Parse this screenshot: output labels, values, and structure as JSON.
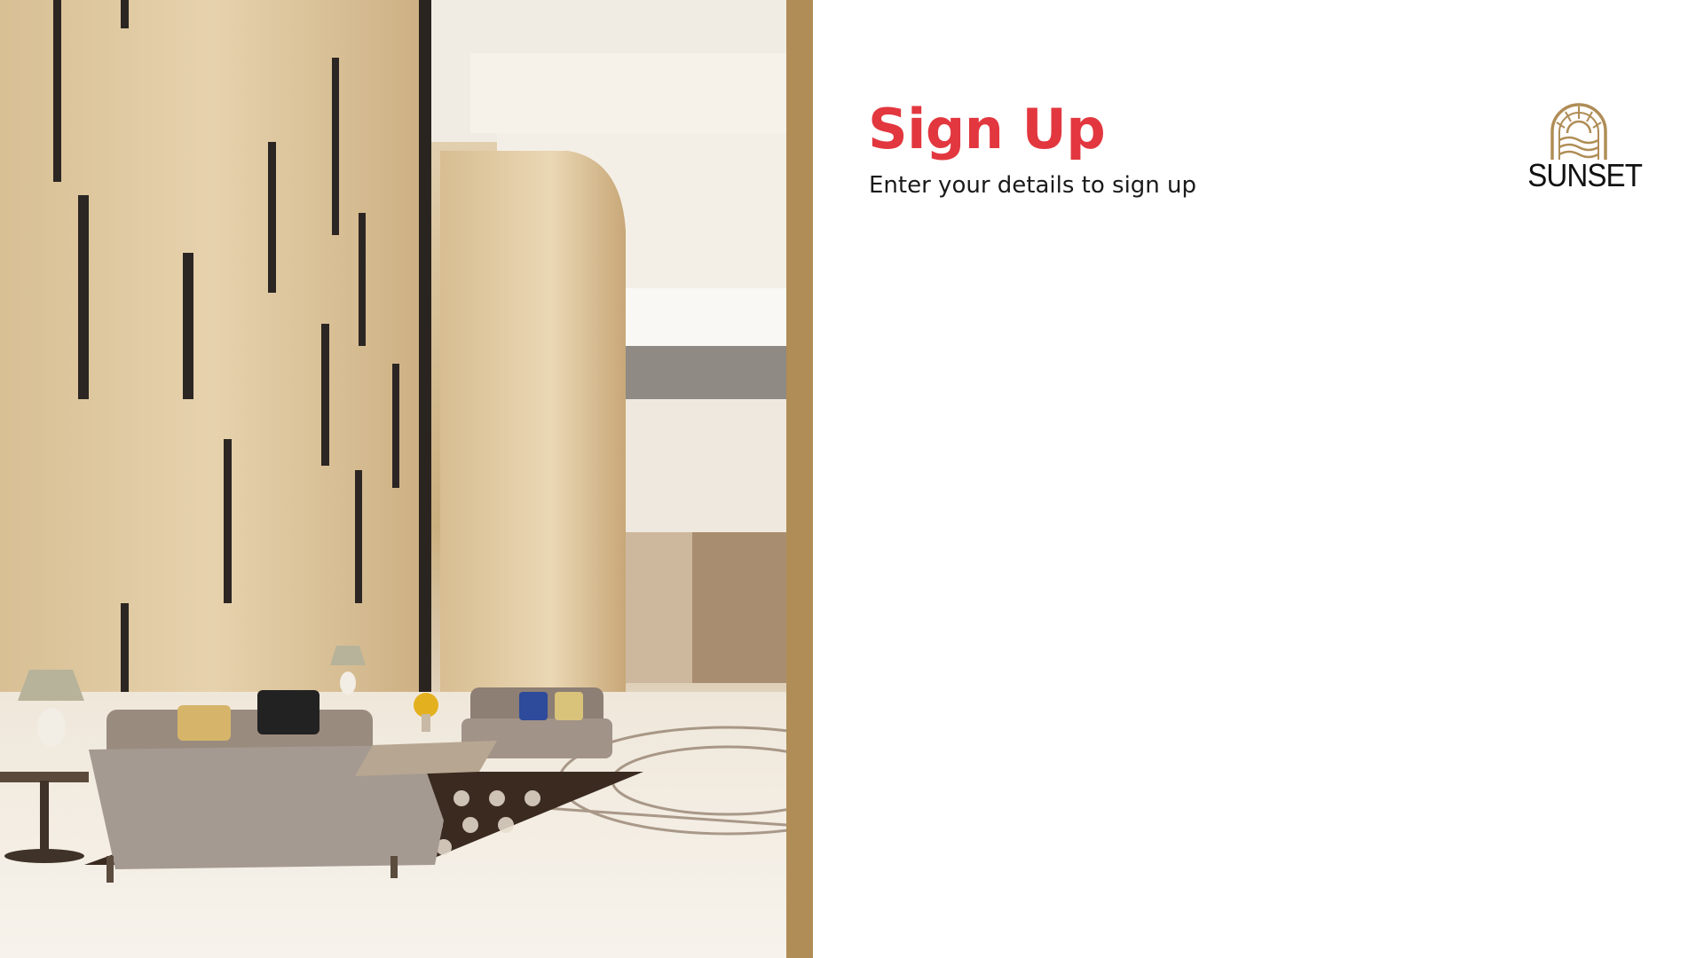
{
  "form": {
    "title": "Sign Up",
    "subtitle": "Enter your details to sign up"
  },
  "brand": {
    "name": "SUNSET",
    "logo_icon": "sunset-arch-icon"
  },
  "hero_image": {
    "subject": "luxury-hotel-lobby-photo"
  },
  "colors": {
    "accent": "#e2373f",
    "gold": "#b08d57",
    "text": "#1a1a1a",
    "background": "#ffffff"
  }
}
